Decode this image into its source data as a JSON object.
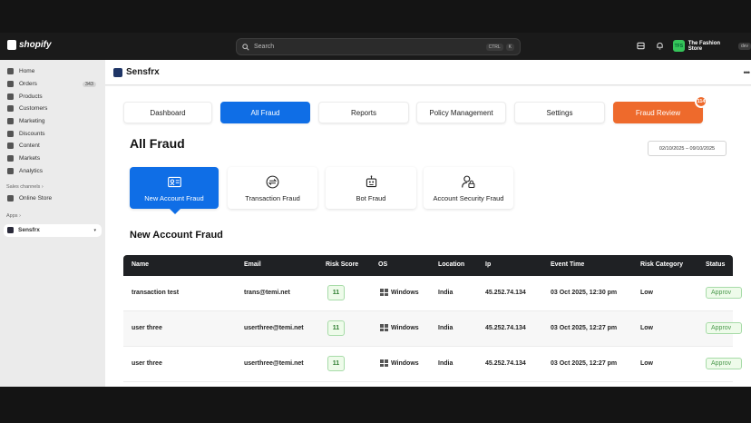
{
  "topbar": {
    "logo_text": "shopify",
    "search_placeholder": "Search",
    "search_kbd": [
      "CTRL",
      "K"
    ],
    "store_initials": "TFS",
    "store_name": "The Fashion Store",
    "store_badge": "dev"
  },
  "sidebar": {
    "items": [
      {
        "label": "Home",
        "icon": "home-icon"
      },
      {
        "label": "Orders",
        "icon": "orders-icon",
        "badge": "343"
      },
      {
        "label": "Products",
        "icon": "tag-icon"
      },
      {
        "label": "Customers",
        "icon": "person-icon"
      },
      {
        "label": "Marketing",
        "icon": "target-icon"
      },
      {
        "label": "Discounts",
        "icon": "discount-icon"
      },
      {
        "label": "Content",
        "icon": "content-icon"
      },
      {
        "label": "Markets",
        "icon": "globe-icon"
      },
      {
        "label": "Analytics",
        "icon": "chart-icon"
      }
    ],
    "sales_channels_label": "Sales channels",
    "online_store_label": "Online Store",
    "apps_label": "Apps",
    "app_name": "Sensfrx"
  },
  "app": {
    "title": "Sensfrx",
    "tabs": [
      {
        "label": "Dashboard"
      },
      {
        "label": "All Fraud",
        "active": true
      },
      {
        "label": "Reports"
      },
      {
        "label": "Policy Management"
      },
      {
        "label": "Settings"
      },
      {
        "label": "Fraud Review",
        "badge": "114"
      }
    ],
    "page_title": "All Fraud",
    "date_range": "02/10/2025 – 09/10/2025",
    "categories": [
      {
        "label": "New Account Fraud",
        "icon": "id-card-icon",
        "active": true
      },
      {
        "label": "Transaction Fraud",
        "icon": "transaction-icon"
      },
      {
        "label": "Bot Fraud",
        "icon": "bot-icon"
      },
      {
        "label": "Account Security Fraud",
        "icon": "user-lock-icon"
      }
    ],
    "section_title": "New Account Fraud",
    "table": {
      "columns": [
        "Name",
        "Email",
        "Risk Score",
        "OS",
        "Location",
        "Ip",
        "Event Time",
        "Risk Category",
        "Status"
      ],
      "rows": [
        {
          "name": "transaction test",
          "email": "trans@temi.net",
          "score": "11",
          "os": "Windows",
          "location": "India",
          "ip": "45.252.74.134",
          "time": "03 Oct 2025, 12:30 pm",
          "category": "Low",
          "status": "Approv"
        },
        {
          "name": "user three",
          "email": "userthree@temi.net",
          "score": "11",
          "os": "Windows",
          "location": "India",
          "ip": "45.252.74.134",
          "time": "03 Oct 2025, 12:27 pm",
          "category": "Low",
          "status": "Approv"
        },
        {
          "name": "user three",
          "email": "userthree@temi.net",
          "score": "11",
          "os": "Windows",
          "location": "India",
          "ip": "45.252.74.134",
          "time": "03 Oct 2025, 12:27 pm",
          "category": "Low",
          "status": "Approv"
        }
      ]
    }
  },
  "colors": {
    "accent": "#0f6ee6",
    "fraud_review": "#ee6a2c",
    "table_header": "#1f2124",
    "success": "#2d7d2f"
  }
}
